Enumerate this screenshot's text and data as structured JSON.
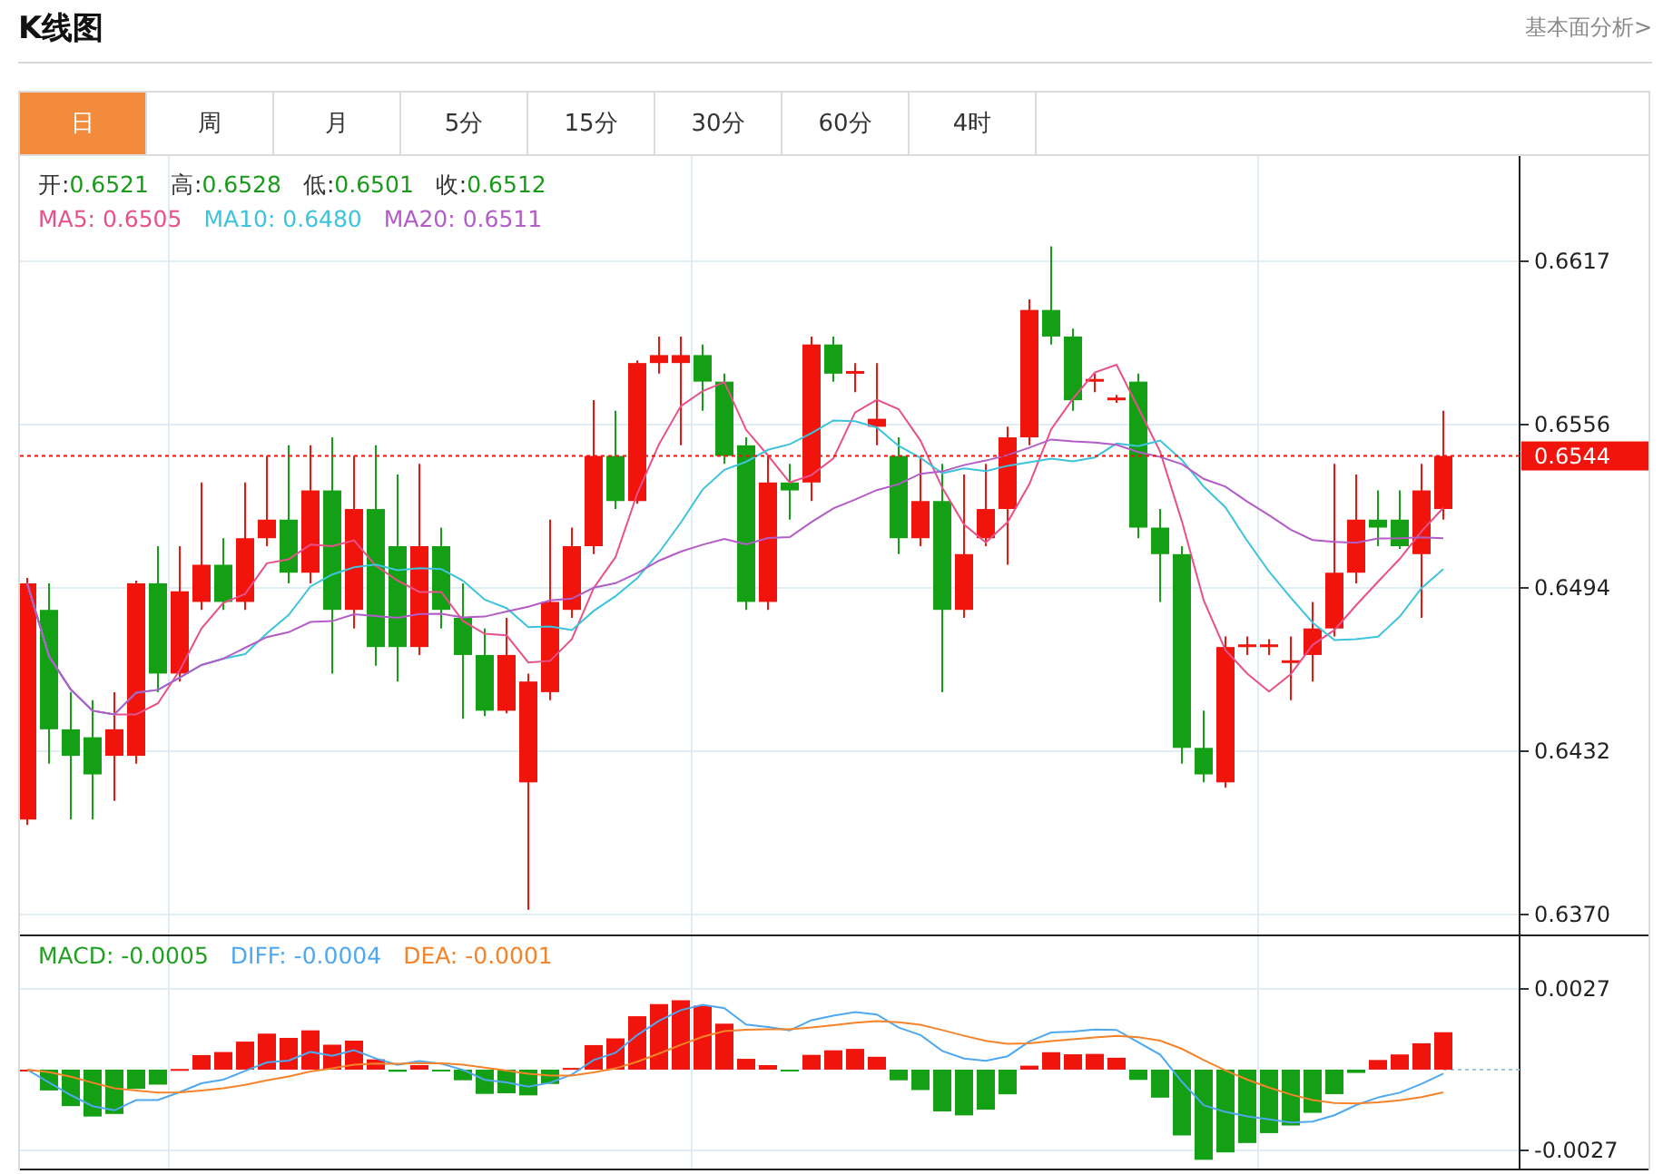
{
  "header": {
    "title": "K线图",
    "link": "基本面分析>"
  },
  "tabs": [
    {
      "label": "日",
      "selected": true
    },
    {
      "label": "周",
      "selected": false
    },
    {
      "label": "月",
      "selected": false
    },
    {
      "label": "5分",
      "selected": false
    },
    {
      "label": "15分",
      "selected": false
    },
    {
      "label": "30分",
      "selected": false
    },
    {
      "label": "60分",
      "selected": false
    },
    {
      "label": "4时",
      "selected": false
    }
  ],
  "price_chart": {
    "quote": [
      {
        "label": "开:",
        "value": "0.6521"
      },
      {
        "label": "高:",
        "value": "0.6528"
      },
      {
        "label": "低:",
        "value": "0.6501"
      },
      {
        "label": "收:",
        "value": "0.6512"
      }
    ],
    "ma_legend": [
      {
        "text": "MA5: 0.6505",
        "color": "#e8508a"
      },
      {
        "text": "MA10: 0.6480",
        "color": "#3ec3dc"
      },
      {
        "text": "MA20: 0.6511",
        "color": "#b35cc8"
      }
    ],
    "axis_labels": [
      "0.6617",
      "0.6556",
      "0.6494",
      "0.6432",
      "0.6370"
    ],
    "last_price": "0.6544"
  },
  "macd_chart": {
    "legend": [
      {
        "text": "MACD: -0.0005",
        "color": "#22a022"
      },
      {
        "text": "DIFF: -0.0004",
        "color": "#4ea8f0"
      },
      {
        "text": "DEA: -0.0001",
        "color": "#f5832a"
      }
    ],
    "axis_labels": [
      "0.0027",
      "-0.0027"
    ]
  }
}
